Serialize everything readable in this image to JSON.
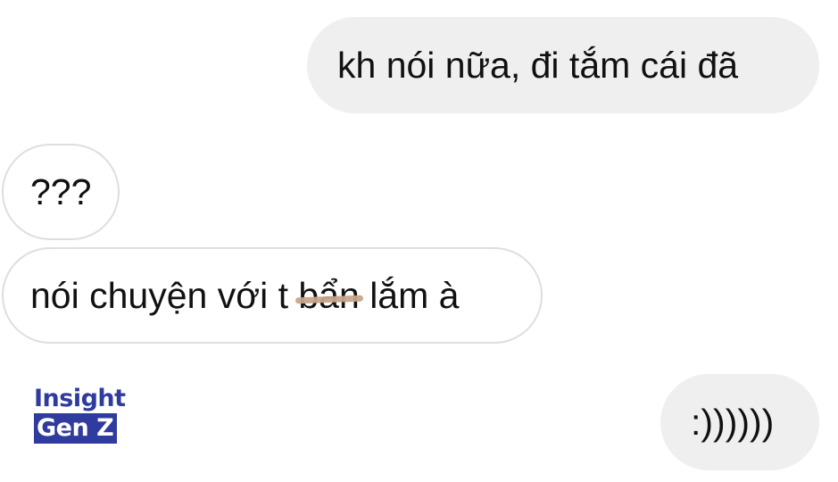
{
  "conversation": {
    "messages": [
      {
        "sender": "me",
        "text": "kh nói nữa, đi tắm cái đã"
      },
      {
        "sender": "other",
        "text": "???"
      },
      {
        "sender": "other",
        "text_before": "nói chuyện với t ",
        "struck_text": "bẩn",
        "text_after": " lắm à"
      },
      {
        "sender": "me",
        "text": ":))))))"
      }
    ]
  },
  "watermark": {
    "line1": "Insight",
    "line2": "Gen Z",
    "color": "#2f3b9e"
  },
  "colors": {
    "sent_bubble": "#efefef",
    "received_border": "#dedede",
    "strike": "#c7a58b"
  }
}
